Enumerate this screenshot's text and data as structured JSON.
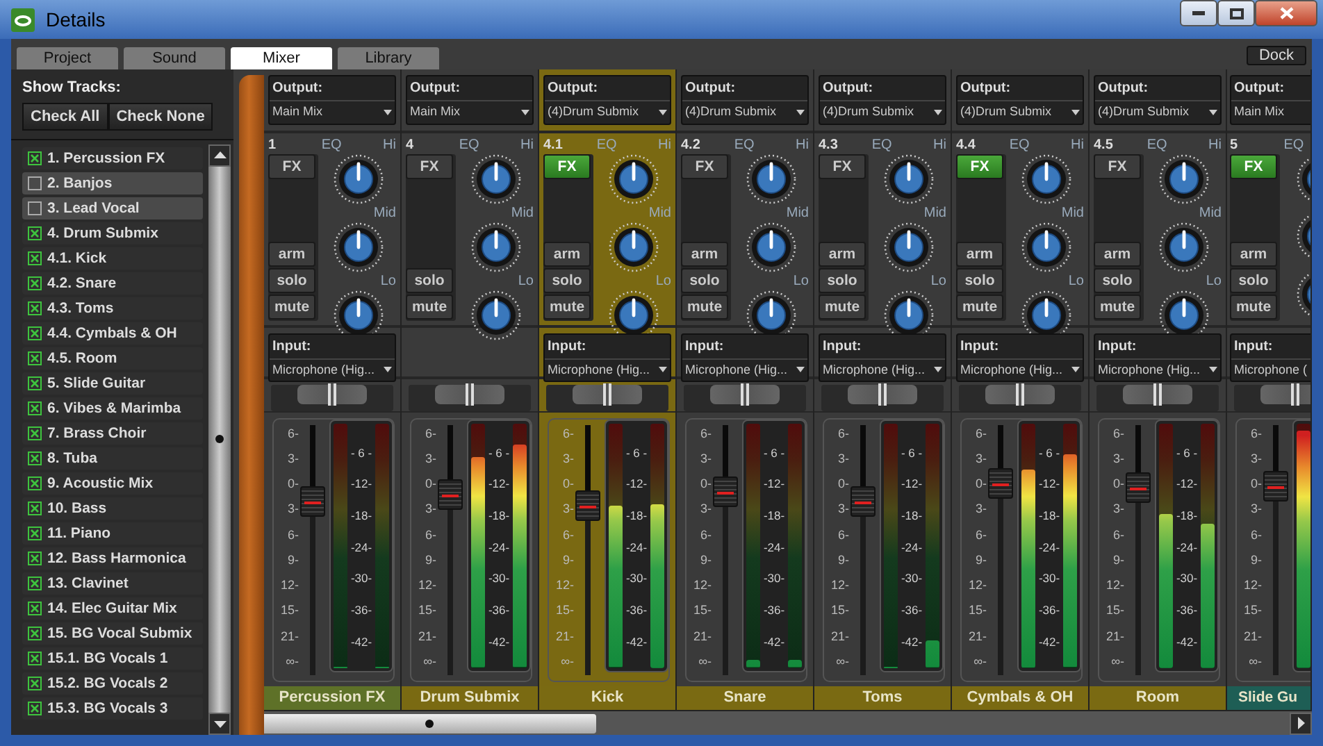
{
  "window": {
    "title": "Details"
  },
  "tabs": [
    {
      "label": "Project",
      "selected": false
    },
    {
      "label": "Sound",
      "selected": false
    },
    {
      "label": "Mixer",
      "selected": true
    },
    {
      "label": "Library",
      "selected": false
    }
  ],
  "dock_button": "Dock",
  "show_tracks": {
    "label": "Show Tracks:",
    "buttons": [
      "Check All",
      "Check None"
    ]
  },
  "tracks": [
    {
      "label": "1. Percussion FX",
      "checked": true
    },
    {
      "label": "2. Banjos",
      "checked": false
    },
    {
      "label": "3. Lead Vocal",
      "checked": false
    },
    {
      "label": "4. Drum Submix",
      "checked": true
    },
    {
      "label": "4.1. Kick",
      "checked": true
    },
    {
      "label": "4.2. Snare",
      "checked": true
    },
    {
      "label": "4.3. Toms",
      "checked": true
    },
    {
      "label": "4.4. Cymbals & OH",
      "checked": true
    },
    {
      "label": "4.5. Room",
      "checked": true
    },
    {
      "label": "5. Slide Guitar",
      "checked": true
    },
    {
      "label": "6. Vibes & Marimba",
      "checked": true
    },
    {
      "label": "7. Brass Choir",
      "checked": true
    },
    {
      "label": "8. Tuba",
      "checked": true
    },
    {
      "label": "9. Acoustic Mix",
      "checked": true
    },
    {
      "label": "10. Bass",
      "checked": true
    },
    {
      "label": "11. Piano",
      "checked": true
    },
    {
      "label": "12. Bass Harmonica",
      "checked": true
    },
    {
      "label": "13. Clavinet",
      "checked": true
    },
    {
      "label": "14. Elec Guitar Mix",
      "checked": true
    },
    {
      "label": "15. BG Vocal Submix",
      "checked": true
    },
    {
      "label": "15.1. BG Vocals 1",
      "checked": true
    },
    {
      "label": "15.2. BG Vocals 2",
      "checked": true
    },
    {
      "label": "15.3. BG Vocals 3",
      "checked": true
    }
  ],
  "channels": [
    {
      "output_label": "Output:",
      "output": "Main Mix",
      "number": "1",
      "eq_label": "EQ",
      "eq": [
        "Hi",
        "Mid",
        "Lo"
      ],
      "fx": "FX",
      "fx_on": false,
      "buttons": [
        "arm",
        "solo",
        "mute"
      ],
      "input_label": "Input:",
      "input": "Microphone (Hig...",
      "pan": {
        "level": 0.5
      },
      "fader_scale": [
        "6-",
        "3-",
        "0-",
        "3-",
        "6-",
        "9-",
        "12-",
        "15-",
        "21-",
        "∞-"
      ],
      "fader": {
        "level": 0.72
      },
      "meter_scale": [
        "- 6 -",
        "-12-",
        "-18-",
        "-24-",
        "-30-",
        "-36-",
        "-42-"
      ],
      "meters": [
        {
          "level": 0
        },
        {
          "level": 0
        }
      ],
      "name": "Percussion FX",
      "color": "#5e7128",
      "selected": false
    },
    {
      "output_label": "Output:",
      "output": "Main Mix",
      "number": "4",
      "eq_label": "EQ",
      "eq": [
        "Hi",
        "Mid",
        "Lo"
      ],
      "fx": "FX",
      "fx_on": false,
      "buttons": [
        "solo",
        "mute"
      ],
      "pan": {
        "level": 0.5
      },
      "fader_scale": [
        "6-",
        "3-",
        "0-",
        "3-",
        "6-",
        "9-",
        "12-",
        "15-",
        "21-",
        "∞-"
      ],
      "fader": {
        "level": 0.75
      },
      "meter_scale": [
        "- 6 -",
        "-12-",
        "-18-",
        "-24-",
        "-30-",
        "-36-",
        "-42-"
      ],
      "meters": [
        {
          "level": 0.86
        },
        {
          "level": 0.91
        }
      ],
      "name": "Drum Submix",
      "color": "#7a6a12",
      "selected": false
    },
    {
      "output_label": "Output:",
      "output": "(4)Drum Submix",
      "number": "4.1",
      "eq_label": "EQ",
      "eq": [
        "Hi",
        "Mid",
        "Lo"
      ],
      "fx": "FX",
      "fx_on": true,
      "buttons": [
        "arm",
        "solo",
        "mute"
      ],
      "input_label": "Input:",
      "input": "Microphone (Hig...",
      "pan": {
        "level": 0.5
      },
      "fader_scale": [
        "6-",
        "3-",
        "0-",
        "3-",
        "6-",
        "9-",
        "12-",
        "15-",
        "21-",
        "∞-"
      ],
      "fader": {
        "level": 0.7
      },
      "meter_scale": [
        "- 6 -",
        "-12-",
        "-18-",
        "-24-",
        "-30-",
        "-36-",
        "-42-"
      ],
      "meters": [
        {
          "level": 0.66
        },
        {
          "level": 0.67
        }
      ],
      "name": "Kick",
      "color": "#7a6a12",
      "selected": true
    },
    {
      "output_label": "Output:",
      "output": "(4)Drum Submix",
      "number": "4.2",
      "eq_label": "EQ",
      "eq": [
        "Hi",
        "Mid",
        "Lo"
      ],
      "fx": "FX",
      "fx_on": false,
      "buttons": [
        "arm",
        "solo",
        "mute"
      ],
      "input_label": "Input:",
      "input": "Microphone (Hig...",
      "pan": {
        "level": 0.5
      },
      "fader_scale": [
        "6-",
        "3-",
        "0-",
        "3-",
        "6-",
        "9-",
        "12-",
        "15-",
        "21-",
        "∞-"
      ],
      "fader": {
        "level": 0.76
      },
      "meter_scale": [
        "- 6 -",
        "-12-",
        "-18-",
        "-24-",
        "-30-",
        "-36-",
        "-42-"
      ],
      "meters": [
        {
          "level": 0.03
        },
        {
          "level": 0.03
        }
      ],
      "name": "Snare",
      "color": "#7a6a12",
      "selected": false
    },
    {
      "output_label": "Output:",
      "output": "(4)Drum Submix",
      "number": "4.3",
      "eq_label": "EQ",
      "eq": [
        "Hi",
        "Mid",
        "Lo"
      ],
      "fx": "FX",
      "fx_on": false,
      "buttons": [
        "arm",
        "solo",
        "mute"
      ],
      "input_label": "Input:",
      "input": "Microphone (Hig...",
      "pan": {
        "level": 0.5
      },
      "fader_scale": [
        "6-",
        "3-",
        "0-",
        "3-",
        "6-",
        "9-",
        "12-",
        "15-",
        "21-",
        "∞-"
      ],
      "fader": {
        "level": 0.72
      },
      "meter_scale": [
        "- 6 -",
        "-12-",
        "-18-",
        "-24-",
        "-30-",
        "-36-",
        "-42-"
      ],
      "meters": [
        {
          "level": 0
        },
        {
          "level": 0.11
        }
      ],
      "name": "Toms",
      "color": "#7a6a12",
      "selected": false
    },
    {
      "output_label": "Output:",
      "output": "(4)Drum Submix",
      "number": "4.4",
      "eq_label": "EQ",
      "eq": [
        "Hi",
        "Mid",
        "Lo"
      ],
      "fx": "FX",
      "fx_on": true,
      "buttons": [
        "arm",
        "solo",
        "mute"
      ],
      "input_label": "Input:",
      "input": "Microphone (Hig...",
      "pan": {
        "level": 0.5
      },
      "fader_scale": [
        "6-",
        "3-",
        "0-",
        "3-",
        "6-",
        "9-",
        "12-",
        "15-",
        "21-",
        "∞-"
      ],
      "fader": {
        "level": 0.8
      },
      "meter_scale": [
        "- 6 -",
        "-12-",
        "-18-",
        "-24-",
        "-30-",
        "-36-",
        "-42-"
      ],
      "meters": [
        {
          "level": 0.81
        },
        {
          "level": 0.87
        }
      ],
      "name": "Cymbals & OH",
      "color": "#7a6a12",
      "selected": false
    },
    {
      "output_label": "Output:",
      "output": "(4)Drum Submix",
      "number": "4.5",
      "eq_label": "EQ",
      "eq": [
        "Hi",
        "Mid",
        "Lo"
      ],
      "fx": "FX",
      "fx_on": false,
      "buttons": [
        "arm",
        "solo",
        "mute"
      ],
      "input_label": "Input:",
      "input": "Microphone (Hig...",
      "pan": {
        "level": 0.5
      },
      "fader_scale": [
        "6-",
        "3-",
        "0-",
        "3-",
        "6-",
        "9-",
        "12-",
        "15-",
        "21-",
        "∞-"
      ],
      "fader": {
        "level": 0.78
      },
      "meter_scale": [
        "- 6 -",
        "-12-",
        "-18-",
        "-24-",
        "-30-",
        "-36-",
        "-42-"
      ],
      "meters": [
        {
          "level": 0.63
        },
        {
          "level": 0.59
        }
      ],
      "name": "Room",
      "color": "#7a6a12",
      "selected": false
    },
    {
      "output_label": "Output:",
      "output": "Main Mix",
      "number": "5",
      "eq_label": "EQ",
      "fx": "FX",
      "fx_on": true,
      "buttons": [
        "arm",
        "solo",
        "mute"
      ],
      "input_label": "Input:",
      "input": "Microphone (",
      "pan": {
        "level": 0.5
      },
      "fader_scale": [
        "6-",
        "3-",
        "0-",
        "3-",
        "6-",
        "9-",
        "12-",
        "15-",
        "21-",
        "∞-"
      ],
      "fader": {
        "level": 0.79
      },
      "meters": [
        {
          "level": 0.97
        }
      ],
      "name": "Slide Gu",
      "color": "#1e5e55",
      "selected": false
    }
  ]
}
